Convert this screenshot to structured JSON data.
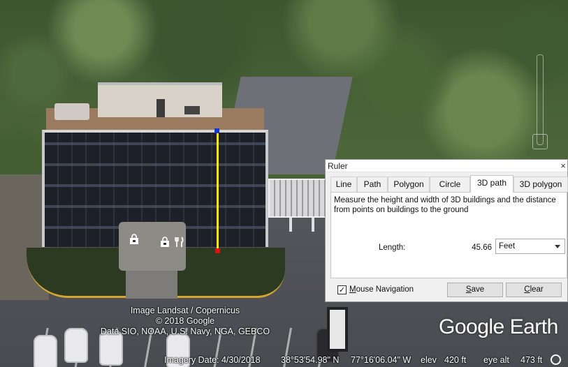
{
  "map": {
    "credits_lines": [
      "Image Landsat / Copernicus",
      "© 2018 Google",
      "Data SIO, NOAA, U.S. Navy, NGA, GEBCO"
    ],
    "brand": "Google Earth"
  },
  "statusbar": {
    "imagery_date": "Imagery Date: 4/30/2018",
    "latitude": "38°53'54.98\" N",
    "longitude": "77°16'06.04\" W",
    "elev_label": "elev",
    "elev_value": "420 ft",
    "eye_alt_label": "eye alt",
    "eye_alt_value": "473 ft"
  },
  "ruler": {
    "title": "Ruler",
    "close_glyph": "×",
    "tabs": [
      {
        "label": "Line",
        "active": false
      },
      {
        "label": "Path",
        "active": false
      },
      {
        "label": "Polygon",
        "active": false
      },
      {
        "label": "Circle",
        "active": false
      },
      {
        "label": "3D path",
        "active": true
      },
      {
        "label": "3D polygon",
        "active": false
      }
    ],
    "description": "Measure the height and width of 3D buildings and the distance from points on buildings to the ground",
    "length_label": "Length:",
    "length_value": "45.66",
    "unit": "Feet",
    "mouse_navigation_label": "Mouse Navigation",
    "mouse_navigation_checked": true,
    "checkmark": "✓",
    "save_label": "Save",
    "clear_label": "Clear"
  },
  "colors": {
    "measure_line": "#ffea00",
    "measure_start": "#1537d6",
    "measure_end": "#e01010"
  },
  "icons": [
    "shopping-bag-icon",
    "shopping-bag-icon",
    "restaurant-icon"
  ]
}
